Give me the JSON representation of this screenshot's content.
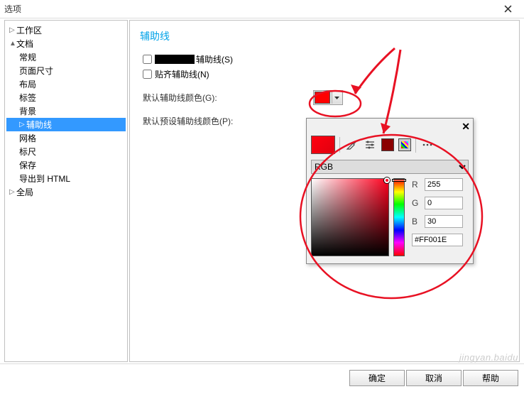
{
  "window": {
    "title": "选项"
  },
  "tree": {
    "workspace": {
      "label": "工作区",
      "expanded": false
    },
    "document": {
      "label": "文档",
      "expanded": true
    },
    "general": {
      "label": "常规"
    },
    "page_size": {
      "label": "页面尺寸"
    },
    "layout": {
      "label": "布局"
    },
    "labels": {
      "label": "标签"
    },
    "background": {
      "label": "背景"
    },
    "guidelines": {
      "label": "辅助线",
      "selected": true,
      "expanded": false
    },
    "grid": {
      "label": "网格"
    },
    "rulers": {
      "label": "标尺"
    },
    "save": {
      "label": "保存"
    },
    "export_html": {
      "label": "导出到 HTML"
    },
    "global": {
      "label": "全局",
      "expanded": false
    }
  },
  "section": {
    "title": "辅助线",
    "show_guides": "辅助线(S)",
    "snap_guides": "贴齐辅助线(N)",
    "default_color": "默认辅助线颜色(G):",
    "default_preset_color": "默认预设辅助线颜色(P):"
  },
  "picker": {
    "mode": "RGB",
    "r_label": "R",
    "g_label": "G",
    "b_label": "B",
    "r": "255",
    "g": "0",
    "b": "30",
    "hex": "#FF001E"
  },
  "buttons": {
    "ok": "确定",
    "cancel": "取消",
    "help": "帮助"
  },
  "watermark": "jingyan.baidu"
}
